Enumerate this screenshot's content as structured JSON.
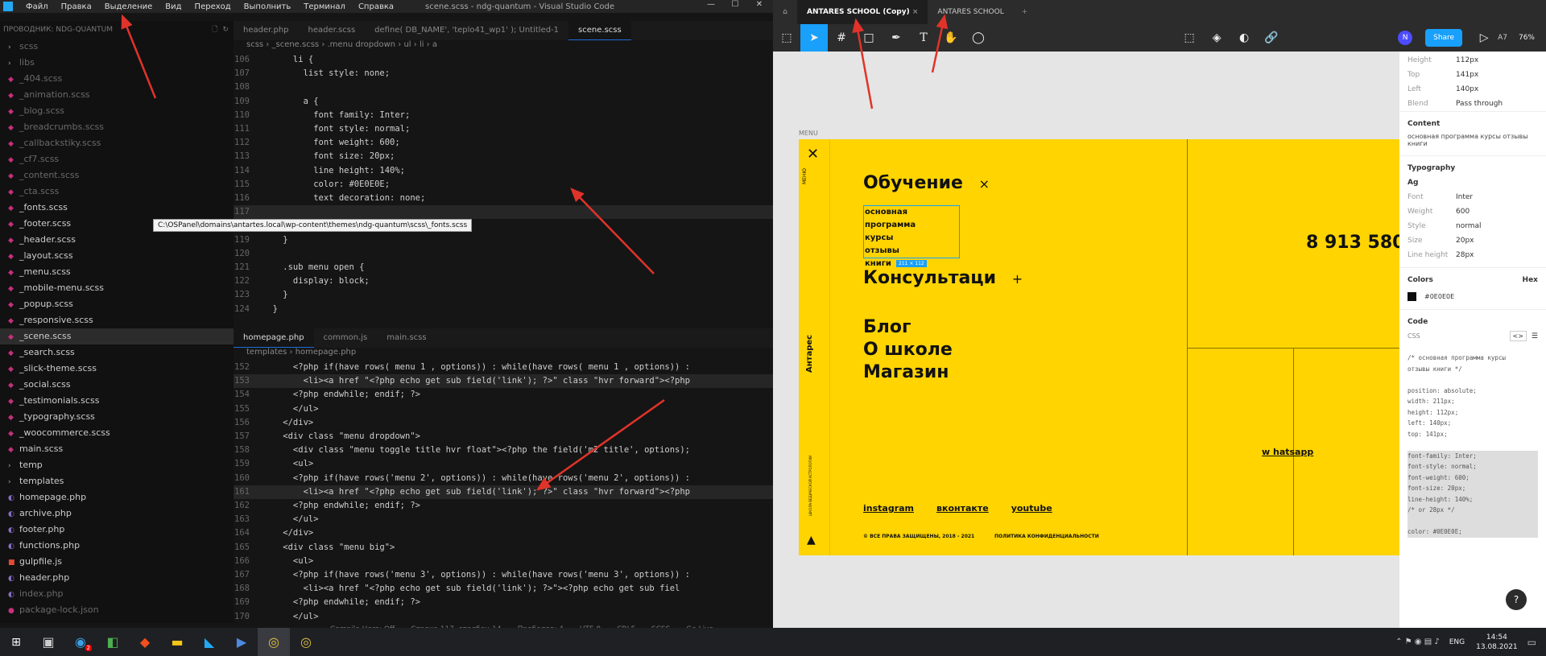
{
  "vscode": {
    "menu": [
      "Файл",
      "Правка",
      "Выделение",
      "Вид",
      "Переход",
      "Выполнить",
      "Терминал",
      "Справка"
    ],
    "window_title": "scene.scss - ndg-quantum - Visual Studio Code",
    "explorer_header": "ПРОВОДНИК: NDG-QUANTUM",
    "explorer_items": [
      {
        "label": "scss",
        "kind": "folder",
        "dim": true
      },
      {
        "label": "libs",
        "kind": "folder",
        "dim": true
      },
      {
        "label": "_404.scss",
        "kind": "scss",
        "dim": true
      },
      {
        "label": "_animation.scss",
        "kind": "scss",
        "dim": true
      },
      {
        "label": "_blog.scss",
        "kind": "scss",
        "dim": true
      },
      {
        "label": "_breadcrumbs.scss",
        "kind": "scss",
        "dim": true
      },
      {
        "label": "_callbackstiky.scss",
        "kind": "scss",
        "dim": true
      },
      {
        "label": "_cf7.scss",
        "kind": "scss",
        "dim": true
      },
      {
        "label": "_content.scss",
        "kind": "scss",
        "dim": true
      },
      {
        "label": "_cta.scss",
        "kind": "scss",
        "dim": true
      },
      {
        "label": "_fonts.scss",
        "kind": "scss",
        "dim": false
      },
      {
        "label": "_footer.scss",
        "kind": "scss",
        "dim": false
      },
      {
        "label": "_header.scss",
        "kind": "scss",
        "dim": false
      },
      {
        "label": "_layout.scss",
        "kind": "scss",
        "dim": false
      },
      {
        "label": "_menu.scss",
        "kind": "scss",
        "dim": false
      },
      {
        "label": "_mobile-menu.scss",
        "kind": "scss",
        "dim": false
      },
      {
        "label": "_popup.scss",
        "kind": "scss",
        "dim": false
      },
      {
        "label": "_responsive.scss",
        "kind": "scss",
        "dim": false
      },
      {
        "label": "_scene.scss",
        "kind": "scss",
        "dim": false,
        "selected": true
      },
      {
        "label": "_search.scss",
        "kind": "scss",
        "dim": false
      },
      {
        "label": "_slick-theme.scss",
        "kind": "scss",
        "dim": false
      },
      {
        "label": "_social.scss",
        "kind": "scss",
        "dim": false
      },
      {
        "label": "_testimonials.scss",
        "kind": "scss",
        "dim": false
      },
      {
        "label": "_typography.scss",
        "kind": "scss",
        "dim": false
      },
      {
        "label": "_woocommerce.scss",
        "kind": "scss",
        "dim": false
      },
      {
        "label": "main.scss",
        "kind": "scss",
        "dim": false
      },
      {
        "label": "temp",
        "kind": "folder",
        "dim": false
      },
      {
        "label": "templates",
        "kind": "folder",
        "dim": false
      },
      {
        "label": "homepage.php",
        "kind": "php",
        "dim": false
      },
      {
        "label": "archive.php",
        "kind": "php",
        "dim": false
      },
      {
        "label": "footer.php",
        "kind": "php",
        "dim": false
      },
      {
        "label": "functions.php",
        "kind": "php",
        "dim": false
      },
      {
        "label": "gulpfile.js",
        "kind": "js",
        "dim": false
      },
      {
        "label": "header.php",
        "kind": "php",
        "dim": false
      },
      {
        "label": "index.php",
        "kind": "php",
        "dim": true
      },
      {
        "label": "package-lock.json",
        "kind": "json",
        "dim": true
      }
    ],
    "tooltip": "C:\\OSPanel\\domains\\antartes.local\\wp-content\\themes\\ndg-quantum\\scss\\_fonts.scss",
    "top_tabs": [
      "header.php",
      "header.scss",
      "define( DB_NAME', 'teplo41_wp1' ); Untitled-1",
      "scene.scss"
    ],
    "top_crumbs": "scss › _scene.scss › .menu dropdown › ul › li › a",
    "top_code": [
      {
        "n": "106",
        "t": "      li {"
      },
      {
        "n": "107",
        "t": "        list style: none;"
      },
      {
        "n": "108",
        "t": ""
      },
      {
        "n": "109",
        "t": "        a {"
      },
      {
        "n": "110",
        "t": "          font family: Inter;"
      },
      {
        "n": "111",
        "t": "          font style: normal;"
      },
      {
        "n": "112",
        "t": "          font weight: 600;"
      },
      {
        "n": "113",
        "t": "          font size: 20px;"
      },
      {
        "n": "114",
        "t": "          line height: 140%;"
      },
      {
        "n": "115",
        "t": "          color: #0E0E0E;"
      },
      {
        "n": "116",
        "t": "          text decoration: none;"
      },
      {
        "n": "117",
        "t": "",
        "hl": true
      },
      {
        "n": "118",
        "t": "      }"
      },
      {
        "n": "119",
        "t": "    }"
      },
      {
        "n": "120",
        "t": ""
      },
      {
        "n": "121",
        "t": "    .sub menu open {"
      },
      {
        "n": "122",
        "t": "      display: block;"
      },
      {
        "n": "123",
        "t": "    }"
      },
      {
        "n": "124",
        "t": "  }"
      }
    ],
    "bottom_tabs": [
      "homepage.php",
      "common.js",
      "main.scss"
    ],
    "bottom_crumbs": "templates › homepage.php",
    "bottom_code": [
      {
        "n": "152",
        "t": "      <?php if(have rows( menu 1 , options)) : while(have rows( menu 1 , options)) :"
      },
      {
        "n": "153",
        "t": "        <li><a href \"<?php echo get sub field('link'); ?>\" class \"hvr forward\"><?php",
        "hl": true
      },
      {
        "n": "154",
        "t": "      <?php endwhile; endif; ?>"
      },
      {
        "n": "155",
        "t": "      </ul>"
      },
      {
        "n": "156",
        "t": "    </div>"
      },
      {
        "n": "157",
        "t": "    <div class \"menu dropdown\">"
      },
      {
        "n": "158",
        "t": "      <div class \"menu toggle title hvr float\"><?php the field('m2 title', options);"
      },
      {
        "n": "159",
        "t": "      <ul>"
      },
      {
        "n": "160",
        "t": "      <?php if(have rows('menu 2', options)) : while(have rows('menu 2', options)) :"
      },
      {
        "n": "161",
        "t": "        <li><a href \"<?php echo get sub field('link'); ?>\" class \"hvr forward\"><?php",
        "hl": true
      },
      {
        "n": "162",
        "t": "      <?php endwhile; endif; ?>"
      },
      {
        "n": "163",
        "t": "      </ul>"
      },
      {
        "n": "164",
        "t": "    </div>"
      },
      {
        "n": "165",
        "t": "    <div class \"menu big\">"
      },
      {
        "n": "166",
        "t": "      <ul>"
      },
      {
        "n": "167",
        "t": "      <?php if(have rows('menu 3', options)) : while(have rows('menu 3', options)) :"
      },
      {
        "n": "168",
        "t": "        <li><a href \"<?php echo get sub field('link'); ?>\"><?php echo get sub fiel"
      },
      {
        "n": "169",
        "t": "      <?php endwhile; endif; ?>"
      },
      {
        "n": "170",
        "t": "      </ul>"
      }
    ],
    "status": [
      "Compile Hero: Off",
      "Строка 117, столбец 14",
      "Пробелов: 4",
      "UTF-8",
      "CRLF",
      "SCSS",
      "Go Live"
    ]
  },
  "figma": {
    "tabs": [
      "ANTARES SCHOOL (Copy)",
      "ANTARES SCHOOL"
    ],
    "share_label": "Share",
    "avatar_letter": "N",
    "zoom": "76%",
    "a7": "A7",
    "frame_label": "MENU",
    "side_menu": "МЕНЮ",
    "side_brand": "Антарес",
    "side_bottom": "ШКОЛА ВЕДИЧЕСКОЙ АСТРОЛОГИИ",
    "heading1": "Обучение",
    "heading1_mark": "×",
    "sub_items": [
      "основная программа",
      "курсы",
      "отзывы",
      "книги"
    ],
    "selection_size": "211 × 112",
    "heading2": "Консультаци",
    "heading2_mark": "+",
    "big_menu": [
      "Блог",
      "О школе",
      "Магазин"
    ],
    "phone": "8 913 580",
    "whatsapp": "w hatsapp",
    "social": [
      "instagram",
      "вконтакте",
      "youtube"
    ],
    "copyright": "© ВСЕ ПРАВА ЗАЩИЩЕНЫ, 2018 - 2021",
    "policy": "ПОЛИТИКА КОНФИДЕНЦИАЛЬНОСТИ",
    "yellow": "#ffd400",
    "props": {
      "size": [
        {
          "k": "Height",
          "v": "112px"
        },
        {
          "k": "Top",
          "v": "141px"
        },
        {
          "k": "Left",
          "v": "140px"
        },
        {
          "k": "Blend",
          "v": "Pass through"
        }
      ],
      "content_title": "Content",
      "content_text": "основная программа курсы отзывы книги",
      "typo_title": "Typography",
      "typo_sample": "Ag",
      "typo": [
        {
          "k": "Font",
          "v": "Inter"
        },
        {
          "k": "Weight",
          "v": "600"
        },
        {
          "k": "Style",
          "v": "normal"
        },
        {
          "k": "Size",
          "v": "20px"
        },
        {
          "k": "Line height",
          "v": "28px"
        }
      ],
      "colors_title": "Colors",
      "colors_mode": "Hex",
      "color_value": "#0E0E0E",
      "code_title": "Code",
      "code_lang": "CSS",
      "code_lines": [
        "/* основная программа курсы",
        "отзывы книги */",
        "",
        "position: absolute;",
        "width: 211px;",
        "height: 112px;",
        "left: 140px;",
        "top: 141px;",
        "",
        "font-family: Inter;",
        "font-style: normal;",
        "font-weight: 600;",
        "font-size: 20px;",
        "line-height: 140%;",
        "/* or 28px */",
        "",
        "color: #0E0E0E;"
      ]
    }
  },
  "taskbar": {
    "lang": "ENG",
    "time": "14:54",
    "date": "13.08.2021",
    "badge": "2"
  }
}
